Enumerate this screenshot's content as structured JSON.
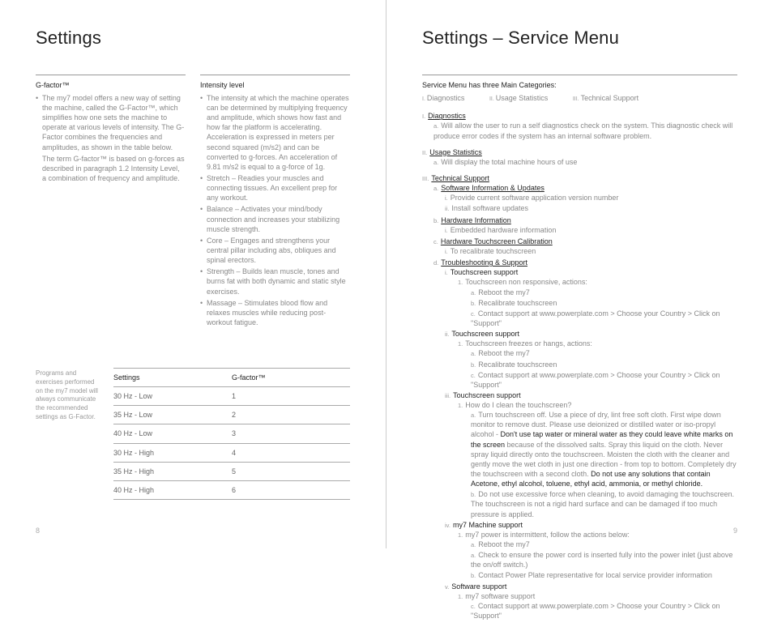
{
  "left": {
    "title": "Settings",
    "gfactor_head": "G-factor™",
    "gfactor_body1": "The my7 model offers a new way of setting the machine, called the G-Factor™, which simplifies how one sets the machine to operate at various levels of intensity. The G-Factor combines the frequencies and amplitudes, as shown in the table below.",
    "gfactor_body2": "The term G-factor™ is based on g-forces as described in paragraph 1.2 Intensity Level, a combination of frequency and amplitude.",
    "intensity_head": "Intensity level",
    "intensity_bullets": [
      "The intensity at which the machine operates can be determined by multiplying frequency and amplitude, which shows how fast and how far the platform is accelerating. Acceleration is expressed in meters per second squared (m/s2) and can be converted to g-forces. An acceleration of 9.81 m/s2 is equal to a g-force of 1g.",
      "Stretch – Readies your muscles and connecting tissues. An excellent prep for any workout.",
      "Balance – Activates your mind/body connection and increases your stabilizing muscle strength.",
      "Core – Engages and strengthens your central pillar including abs, obliques and spinal erectors.",
      "Strength – Builds lean muscle, tones and burns fat with both dynamic and static style exercises.",
      "Massage – Stimulates blood flow and relaxes muscles while reducing post-workout fatigue."
    ],
    "sidenote": "Programs and exercises performed on the my7 model will always communicate the recommended settings as G-Factor.",
    "table_h1": "Settings",
    "table_h2": "G-factor™",
    "table_rows": [
      [
        "30 Hz - Low",
        "1"
      ],
      [
        "35 Hz - Low",
        "2"
      ],
      [
        "40 Hz - Low",
        "3"
      ],
      [
        "30 Hz - High",
        "4"
      ],
      [
        "35 Hz - High",
        "5"
      ],
      [
        "40 Hz - High",
        "6"
      ]
    ],
    "pagenum": "8"
  },
  "right": {
    "title": "Settings – Service Menu",
    "intro": "Service Menu has three Main Categories:",
    "cats": [
      "Diagnostics",
      "Usage Statistics",
      "Technical Support"
    ],
    "diag_lbl": "Diagnostics",
    "diag_a": "Will allow the  user to run a self diagnostics check on the system. This diagnostic check will produce error codes if the system has an internal software problem.",
    "usage_lbl": "Usage Statistics",
    "usage_a": "Will display the total machine hours of use",
    "tech_lbl": "Technical Support",
    "sw_lbl": "Software Information & Updates",
    "sw_i": "Provide current software application version number",
    "sw_ii": "Install software updates",
    "hw_lbl": "Hardware Information",
    "hw_i": "Embedded hardware information",
    "cal_lbl": "Hardware Touchscreen Calibration",
    "cal_i": "To recalibrate touchscreen",
    "tr_lbl": "Troubleshooting & Support",
    "ts1_lbl": "Touchscreen support",
    "ts1_1": "Touchscreen non responsive, actions:",
    "ts1_a": "Reboot the my7",
    "ts1_b": "Recalibrate touchscreen",
    "ts1_c": "Contact support at www.powerplate.com > Choose your Country > Click on \"Support\"",
    "ts2_lbl": "Touchscreen support",
    "ts2_1": "Touchscreen freezes or hangs,  actions:",
    "ts2_a": "Reboot the my7",
    "ts2_b": "Recalibrate touchscreen",
    "ts2_c": "Contact support at www.powerplate.com > Choose your Country > Click on \"Support\"",
    "ts3_lbl": "Touchscreen support",
    "ts3_1": "How do I clean the touchscreen?",
    "ts3_a_pre": "Turn touchscreen off. Use a piece of dry, lint free soft cloth. First wipe down monitor to remove dust. Please use deionized or distilled water or iso-propyl alcohol - ",
    "ts3_a_bold1": "Don't use tap water or mineral water as they could leave white marks on the screen ",
    "ts3_a_mid": "because of the dissolved salts. Spray this liquid on the cloth. Never spray liquid directly onto the  touchscreen. Moisten the cloth with the cleaner and gently move the wet cloth in just one direction -  from top to bottom. Completely dry the touchscreen with a second cloth. ",
    "ts3_a_bold2": "Do not use any solutions that contain Acetone, ethyl alcohol, toluene, ethyl acid, ammonia, or methyl chloride.",
    "ts3_b": "Do not use excessive force when cleaning, to avoid damaging the touchscreen. The touchscreen is not a rigid hard surface and can be damaged if too much pressure is applied.",
    "ms_lbl": "my7 Machine support",
    "ms_1": "my7 power is intermittent, follow the actions below:",
    "ms_a": "Reboot the my7",
    "ms_aa": "Check to ensure the power cord is inserted fully into the power inlet (just above the on/off switch.)",
    "ms_b": "Contact Power Plate representative for local service provider information",
    "ss_lbl": "Software support",
    "ss_1": "my7 software support",
    "ss_c": "Contact support at www.powerplate.com > Choose your Country > Click on \"Support\"",
    "pagenum": "9"
  }
}
